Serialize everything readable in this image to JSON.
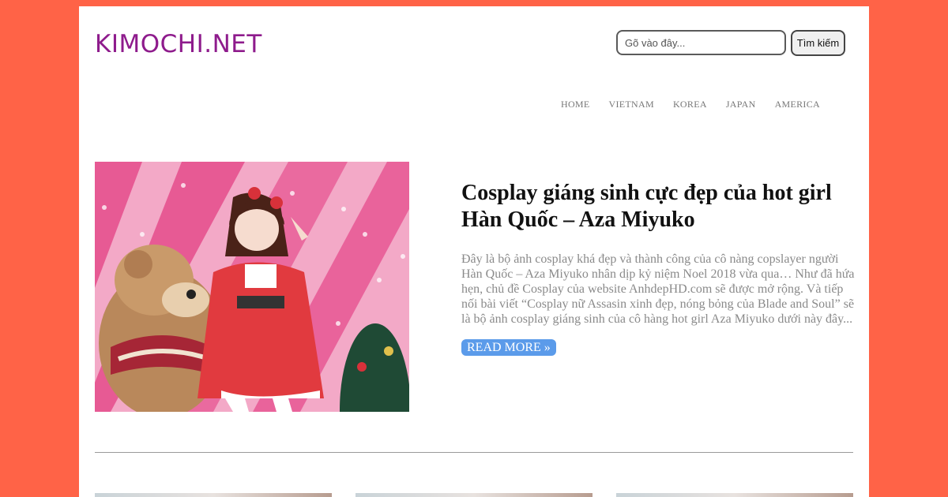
{
  "site": {
    "logo": "KIMOCHI.NET"
  },
  "search": {
    "placeholder": "Gõ vào đây...",
    "button_label": "Tìm kiếm"
  },
  "nav": {
    "items": [
      "HOME",
      "VIETNAM",
      "KOREA",
      "JAPAN",
      "AMERICA"
    ]
  },
  "post": {
    "title": "Cosplay giáng sinh cực đẹp của hot girl Hàn Quốc – Aza Miyuko",
    "excerpt": "Đây là bộ ảnh cosplay khá đẹp và thành công của cô nàng copslayer người Hàn Quốc – Aza Miyuko nhân dịp kỷ niệm Noel 2018 vừa qua… Như đã hứa hẹn, chủ đề Cosplay của website AnhdepHD.com sẽ được mở rộng. Và tiếp nối bài viết “Cosplay nữ Assasin xinh đẹp, nóng bỏng của Blade and Soul” sẽ là bộ ảnh cosplay giáng sinh của cô hàng hot girl Aza Miyuko dưới này đây...",
    "read_more": "READ MORE »"
  },
  "colors": {
    "background": "#ff6347",
    "logo": "#8e1b8c",
    "read_more_bg": "#5b9bea",
    "excerpt": "#8a8a8a"
  }
}
